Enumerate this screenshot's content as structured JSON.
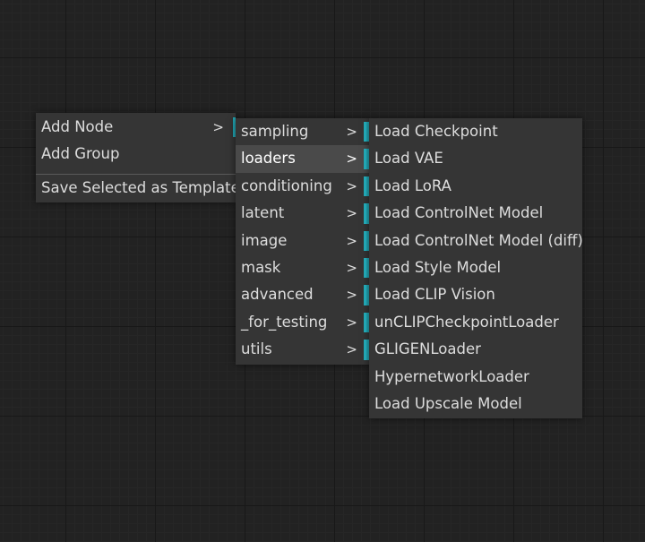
{
  "context_menu": {
    "items": [
      {
        "label": "Add Node",
        "arrow": ">"
      },
      {
        "label": "Add Group"
      },
      {
        "label": "Save Selected as Template"
      }
    ]
  },
  "category_menu": {
    "items": [
      {
        "label": "sampling",
        "arrow": ">"
      },
      {
        "label": "loaders",
        "arrow": ">"
      },
      {
        "label": "conditioning",
        "arrow": ">"
      },
      {
        "label": "latent",
        "arrow": ">"
      },
      {
        "label": "image",
        "arrow": ">"
      },
      {
        "label": "mask",
        "arrow": ">"
      },
      {
        "label": "advanced",
        "arrow": ">"
      },
      {
        "label": "_for_testing",
        "arrow": ">"
      },
      {
        "label": "utils",
        "arrow": ">"
      }
    ]
  },
  "loaders_menu": {
    "items": [
      {
        "label": "Load Checkpoint"
      },
      {
        "label": "Load VAE"
      },
      {
        "label": "Load LoRA"
      },
      {
        "label": "Load ControlNet Model"
      },
      {
        "label": "Load ControlNet Model (diff)"
      },
      {
        "label": "Load Style Model"
      },
      {
        "label": "Load CLIP Vision"
      },
      {
        "label": "unCLIPCheckpointLoader"
      },
      {
        "label": "GLIGENLoader"
      },
      {
        "label": "HypernetworkLoader"
      },
      {
        "label": "Load Upscale Model"
      }
    ]
  },
  "colors": {
    "canvas_bg": "#222222",
    "menu_bg": "#353535",
    "highlight_bg": "#4a4a4a",
    "accent": "#22a6b3",
    "text": "#dddddd"
  }
}
